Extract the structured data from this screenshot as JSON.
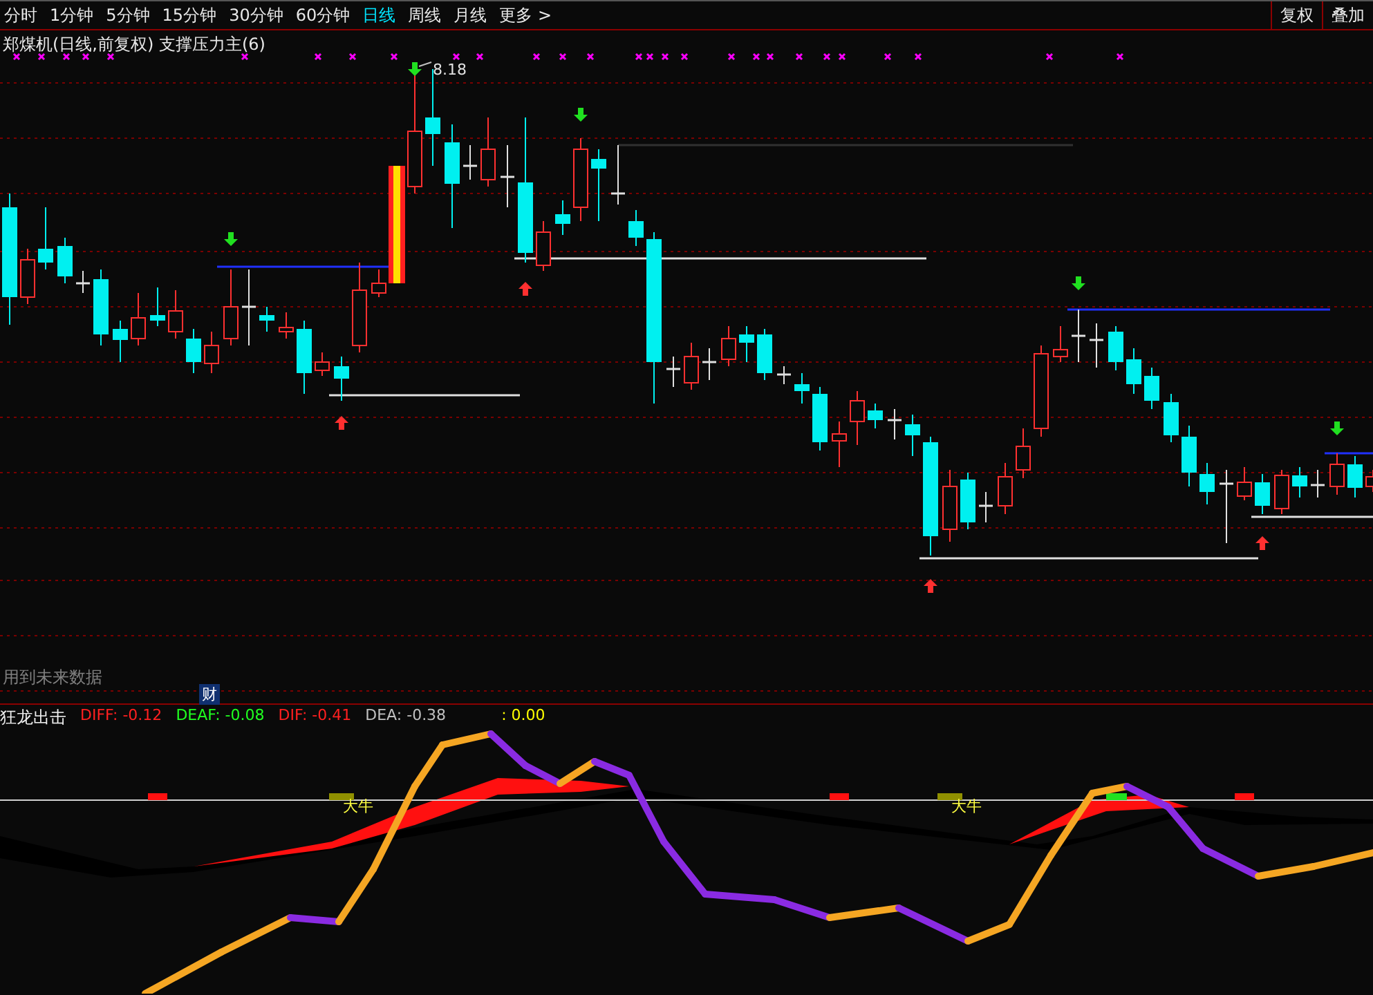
{
  "toolbar": {
    "tabs": [
      {
        "label": "分时",
        "selected": false
      },
      {
        "label": "1分钟",
        "selected": false
      },
      {
        "label": "5分钟",
        "selected": false
      },
      {
        "label": "15分钟",
        "selected": false
      },
      {
        "label": "30分钟",
        "selected": false
      },
      {
        "label": "60分钟",
        "selected": false
      },
      {
        "label": "日线",
        "selected": true
      },
      {
        "label": "周线",
        "selected": false
      },
      {
        "label": "月线",
        "selected": false
      },
      {
        "label": "更多 >",
        "selected": false
      }
    ],
    "buttons": [
      "复权",
      "叠加"
    ]
  },
  "chart": {
    "title": "郑煤机(日线,前复权) 支撑压力主(6)",
    "high_label": "8.18",
    "warning": "用到未来数据",
    "badge": "财"
  },
  "indicator": {
    "name": "狂龙出击",
    "values": [
      {
        "label": "DIFF: -0.12",
        "color": "#ff2020"
      },
      {
        "label": "DEAF: -0.08",
        "color": "#20ff20"
      },
      {
        "label": "DIF: -0.41",
        "color": "#ff2020"
      },
      {
        "label": "DEA: -0.38",
        "color": "#c0c0c0"
      },
      {
        "label": ": 0.00",
        "color": "#ffff00"
      }
    ],
    "signals": [
      {
        "label": "大牛"
      },
      {
        "label": "大牛"
      }
    ]
  }
}
